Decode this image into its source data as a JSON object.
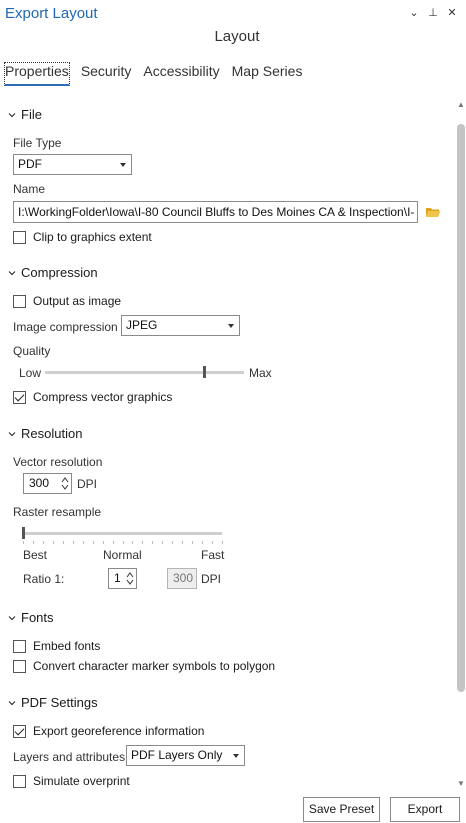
{
  "pane": {
    "title": "Export Layout",
    "subtitle": "Layout"
  },
  "tabs": [
    "Properties",
    "Security",
    "Accessibility",
    "Map Series"
  ],
  "file": {
    "header": "File",
    "file_type_label": "File Type",
    "file_type_value": "PDF",
    "name_label": "Name",
    "name_value": "I:\\WorkingFolder\\Iowa\\I-80 Council Bluffs to Des Moines CA & Inspection\\I-",
    "clip_label": "Clip to graphics extent",
    "clip_checked": false
  },
  "compression": {
    "header": "Compression",
    "output_as_image_label": "Output as image",
    "output_as_image_checked": false,
    "image_compression_label": "Image compression",
    "image_compression_value": "JPEG",
    "quality_label": "Quality",
    "quality_min_label": "Low",
    "quality_max_label": "Max",
    "quality_level": 0.8,
    "compress_vector_label": "Compress vector graphics",
    "compress_vector_checked": true
  },
  "resolution": {
    "header": "Resolution",
    "vector_resolution_label": "Vector resolution",
    "vector_resolution_value": "300",
    "dpi_label": "DPI",
    "raster_resample_label": "Raster resample",
    "resample_level": 0.0,
    "best_label": "Best",
    "normal_label": "Normal",
    "fast_label": "Fast",
    "ratio_label": "Ratio 1:",
    "ratio_value": "1",
    "ratio_dpi_value": "300",
    "ratio_dpi_label": "DPI"
  },
  "fonts": {
    "header": "Fonts",
    "embed_fonts_label": "Embed fonts",
    "embed_fonts_checked": false,
    "convert_markers_label": "Convert character marker symbols to polygon",
    "convert_markers_checked": false
  },
  "pdf_settings": {
    "header": "PDF Settings",
    "export_georef_label": "Export georeference information",
    "export_georef_checked": true,
    "layers_attributes_label": "Layers and attributes",
    "layers_attributes_value": "PDF Layers Only",
    "simulate_overprint_label": "Simulate overprint",
    "simulate_overprint_checked": false
  },
  "footer": {
    "save_preset_label": "Save Preset",
    "export_label": "Export"
  },
  "colors": {
    "accent": "#1f69b4",
    "border": "#8a8a8a",
    "folder": "#e8b73a"
  },
  "icons": [
    "chevron-down-icon",
    "pin-icon",
    "close-icon",
    "folder-open-icon",
    "spin-arrows-icon",
    "dropdown-caret-icon"
  ]
}
